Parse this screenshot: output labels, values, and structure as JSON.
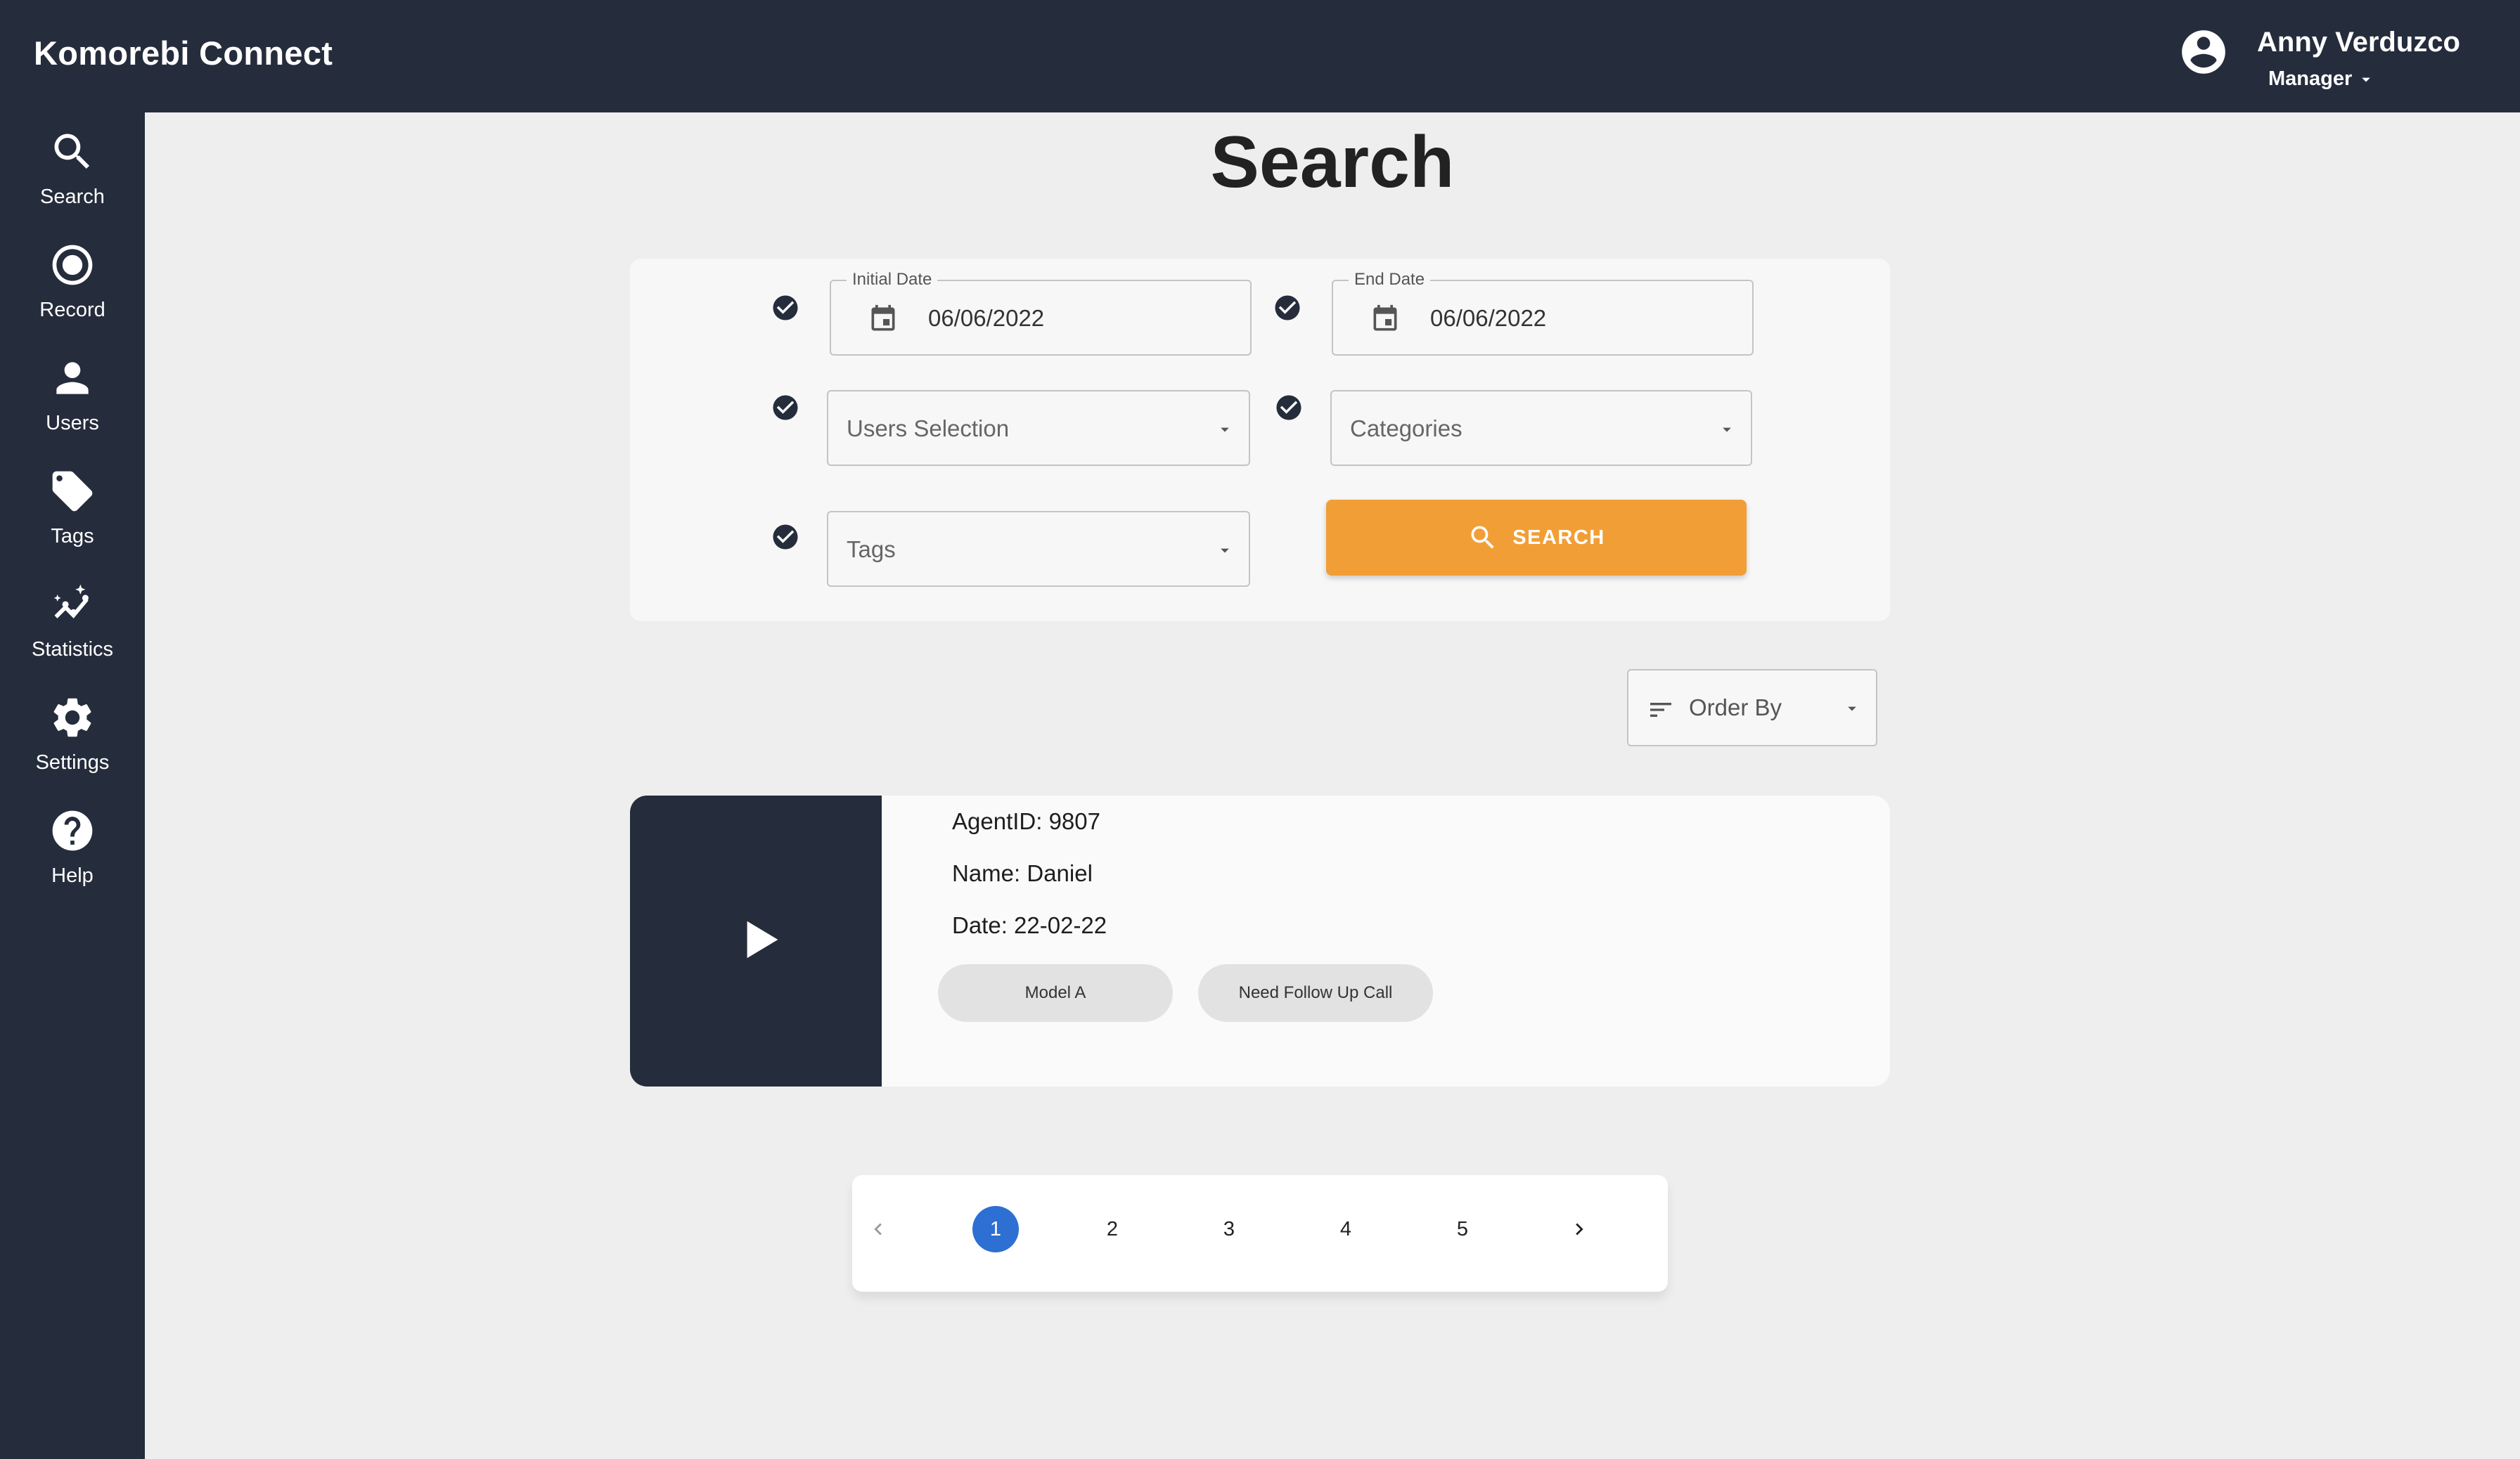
{
  "app": {
    "title": "Komorebi Connect"
  },
  "user": {
    "name": "Anny Verduzco",
    "role": "Manager"
  },
  "sidebar": {
    "items": [
      {
        "label": "Search",
        "icon": "search-icon"
      },
      {
        "label": "Record",
        "icon": "record-icon"
      },
      {
        "label": "Users",
        "icon": "user-icon"
      },
      {
        "label": "Tags",
        "icon": "tag-icon"
      },
      {
        "label": "Statistics",
        "icon": "statistics-icon"
      },
      {
        "label": "Settings",
        "icon": "gear-icon"
      },
      {
        "label": "Help",
        "icon": "help-icon"
      }
    ]
  },
  "main": {
    "title": "Search",
    "filters": {
      "initial_date": {
        "label": "Initial Date",
        "value": "06/06/2022"
      },
      "end_date": {
        "label": "End Date",
        "value": "06/06/2022"
      },
      "users_selection": {
        "placeholder": "Users Selection"
      },
      "categories": {
        "placeholder": "Categories"
      },
      "tags": {
        "placeholder": "Tags"
      },
      "search_button": "SEARCH"
    },
    "order_by": "Order By",
    "results": [
      {
        "agent_id": "AgentID: 9807",
        "name": "Name: Daniel",
        "date": "Date: 22-02-22",
        "chips": [
          "Model A",
          "Need Follow Up Call"
        ]
      }
    ],
    "pagination": {
      "pages": [
        "1",
        "2",
        "3",
        "4",
        "5"
      ],
      "current": "1"
    }
  },
  "colors": {
    "navy": "#252c3c",
    "accent_orange": "#f29e36",
    "active_page": "#2e6fd4",
    "background": "#eeeeee"
  }
}
